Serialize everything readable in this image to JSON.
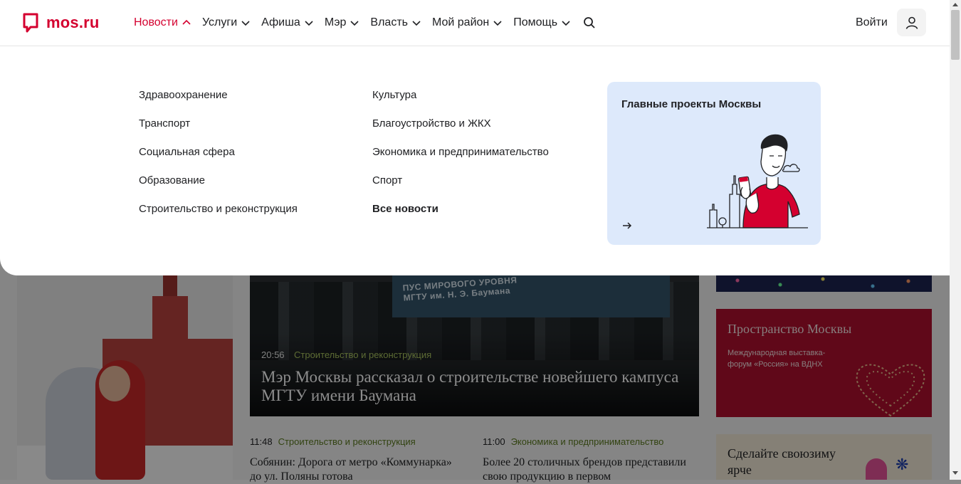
{
  "header": {
    "logo_text": "mos.ru",
    "nav": [
      {
        "label": "Новости",
        "active": true
      },
      {
        "label": "Услуги"
      },
      {
        "label": "Афиша"
      },
      {
        "label": "Мэр"
      },
      {
        "label": "Власть"
      },
      {
        "label": "Мой район"
      },
      {
        "label": "Помощь"
      }
    ],
    "login_label": "Войти"
  },
  "dropdown": {
    "column1": [
      "Здравоохранение",
      "Транспорт",
      "Социальная сфера",
      "Образование",
      "Строительство и реконструкция"
    ],
    "column2": [
      "Культура",
      "Благоустройство и ЖКХ",
      "Экономика и предпринимательство",
      "Спорт"
    ],
    "all_news": "Все новости",
    "projects_title": "Главные проекты Москвы"
  },
  "background": {
    "banner_text": "ПУС МИРОВОГО УРОВНЯ\nМГТУ им. Н. Э. Баумана",
    "main_news": {
      "time": "20:56",
      "category": "Строительство и реконструкция",
      "title": "Мэр Москвы рассказал о строительстве новейшего кампуса МГТУ имени Баумана"
    },
    "news": [
      {
        "time": "11:48",
        "category": "Строительство и реконструкция",
        "title": "Собянин: Дорога от метро «Коммунарка» до ул. Поляны готова"
      },
      {
        "time": "11:00",
        "category": "Экономика и предпринимательство",
        "title": "Более 20 столичных брендов представили свою продукцию в первом"
      }
    ],
    "promo_space": {
      "title": "Пространство Москвы",
      "text": "Международная выставка-форум «Россия» на ВДНХ"
    },
    "promo_winter": {
      "text": "Сделайте своюзиму ярче"
    }
  },
  "colors": {
    "brand": "#d4002f",
    "projects_bg": "#dde9fb",
    "category_green": "#5b7a1f"
  }
}
